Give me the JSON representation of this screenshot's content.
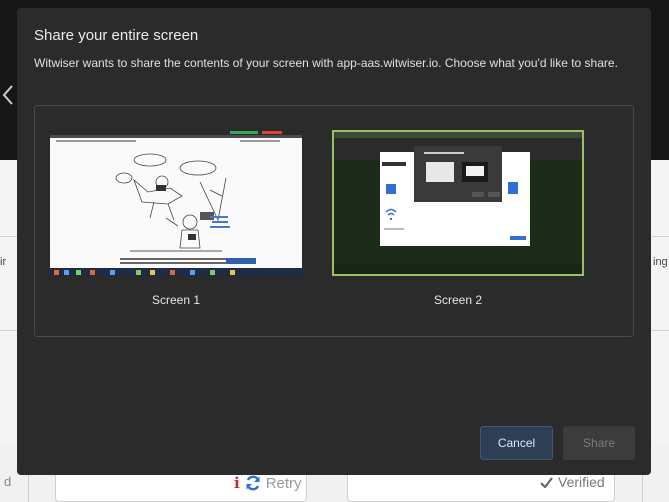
{
  "dialog": {
    "title": "Share your entire screen",
    "description": "Witwiser wants to share the contents of your screen with app-aas.witwiser.io. Choose what you'd like to share.",
    "screens": [
      {
        "label": "Screen 1"
      },
      {
        "label": "Screen 2"
      }
    ],
    "cancel_label": "Cancel",
    "share_label": "Share"
  },
  "background": {
    "left_cut_text": "ir",
    "right_cut_text": "ing",
    "bottom_left_cut_text": "d",
    "retry_label": "Retry",
    "verified_label": "Verified"
  },
  "colors": {
    "dialog_bg": "#2b2b2b",
    "cancel_bg": "#2d3e55",
    "selected_border": "#9bbf66",
    "info_icon": "#c62a2a",
    "retry_icon": "#2f6fd6"
  }
}
